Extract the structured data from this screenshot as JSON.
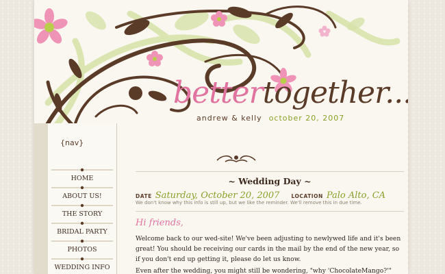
{
  "logo": {
    "better": "better",
    "together": "together...",
    "names": "andrew & kelly",
    "date": "october 20, 2007"
  },
  "nav": {
    "title": "{nav}",
    "items": [
      "HOME",
      "ABOUT US!",
      "THE STORY",
      "BRIDAL PARTY",
      "PHOTOS",
      "WEDDING INFO"
    ]
  },
  "post": {
    "title": "~ Wedding Day ~",
    "date_label": "DATE",
    "date_value": "Saturday, October 20, 2007",
    "location_label": "LOCATION",
    "location_value": "Palo Alto, CA",
    "note": "We don't know why this info is still up, but we like the reminder. We'll remove this in due time.",
    "greeting": "Hi friends,",
    "paragraph1": "Welcome back to our wed-site! We've been adjusting to newlywed life and it's been great! You should be receiving our cards in the mail by the end of the new year, so if you don't end up getting it, please do let us know.",
    "paragraph2": "Even after the wedding, you might still be wondering, \"why 'ChocolateMango?'\""
  },
  "colors": {
    "pink": "#e0739f",
    "brown": "#5a3b28",
    "green": "#8ba028",
    "light_green": "#cfe0a0"
  }
}
